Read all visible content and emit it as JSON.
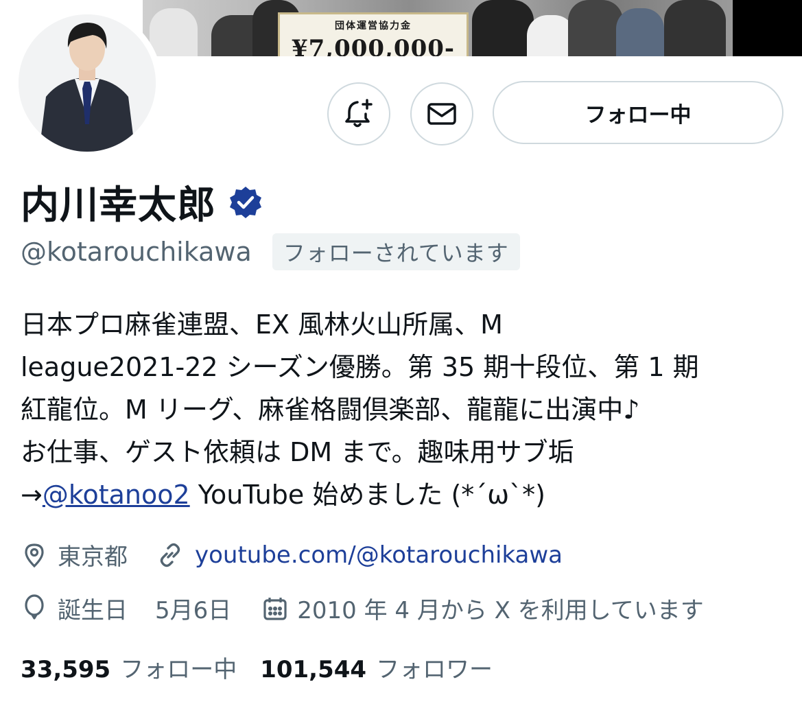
{
  "banner": {
    "sign_title": "団体運営協力金",
    "sign_amount": "¥7,000,000-"
  },
  "actions": {
    "notify_icon": "bell-plus-icon",
    "message_icon": "envelope-icon",
    "follow_label": "フォロー中"
  },
  "profile": {
    "name": "内川幸太郎",
    "verified_icon": "verified-badge-icon",
    "handle": "@kotarouchikawa",
    "follows_you": "フォローされています",
    "bio_line1": "日本プロ麻雀連盟、EX 風林火山所属、M",
    "bio_line2": "league2021-22 シーズン優勝。第 35 期十段位、第 1 期",
    "bio_line3": "紅龍位。M リーグ、麻雀格闘倶楽部、龍龍に出演中♪",
    "bio_line4": "お仕事、ゲスト依頼は DM まで。趣味用サブ垢",
    "bio_arrow": "→",
    "bio_mention": "@kotanoo2",
    "bio_tail": " YouTube 始めました (*´ω`*)",
    "location": "東京都",
    "website": "youtube.com/@kotarouchikawa",
    "birthday_label": "誕生日",
    "birthday": "5月6日",
    "joined": "2010 年 4 月から X を利用しています"
  },
  "stats": {
    "following_count": "33,595",
    "following_label": "フォロー中",
    "followers_count": "101,544",
    "followers_label": "フォロワー"
  },
  "colors": {
    "text": "#0f1419",
    "secondary": "#536471",
    "link": "#1d3f99",
    "border": "#cfd9de",
    "verified": "#1d3f99"
  }
}
